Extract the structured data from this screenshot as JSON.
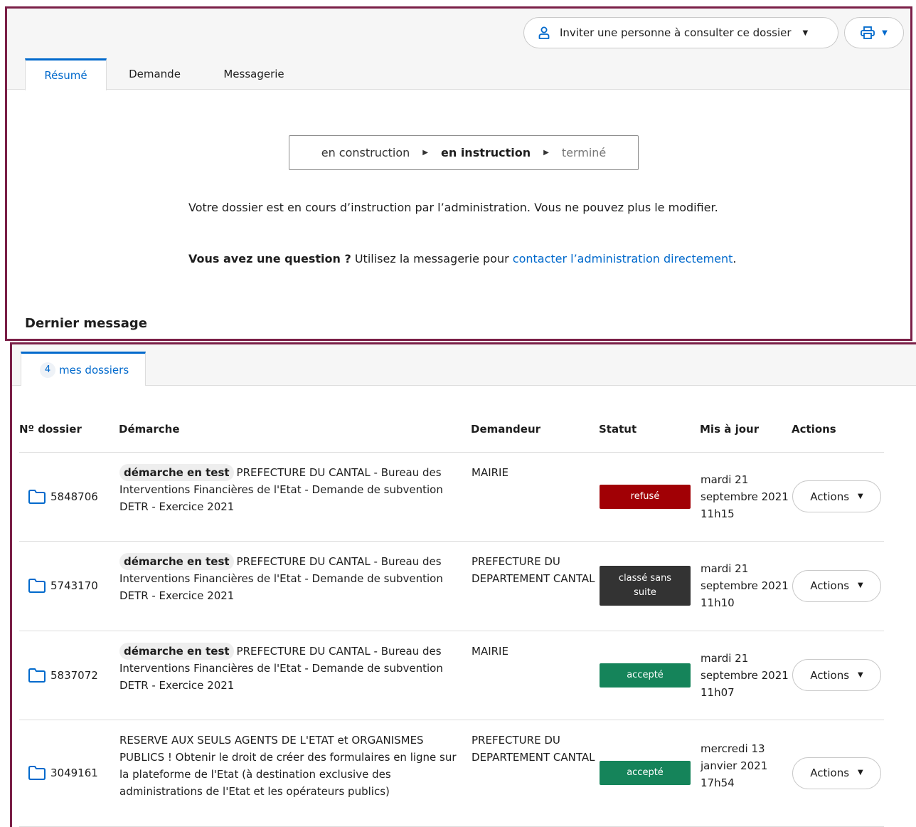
{
  "header": {
    "invite_label": "Inviter une personne à consulter ce dossier",
    "invite_icon": "user-icon",
    "print_icon": "printer-icon",
    "accent_color": "#0069cc"
  },
  "tabs": [
    {
      "label": "Résumé",
      "active": true
    },
    {
      "label": "Demande",
      "active": false
    },
    {
      "label": "Messagerie",
      "active": false
    }
  ],
  "status_steps": [
    "en construction",
    "en instruction",
    "terminé"
  ],
  "status_text": "Votre dossier est en cours d’instruction par l’administration. Vous ne pouvez plus le modifier.",
  "question": {
    "bold": "Vous avez une question ?",
    "text": "Utilisez la messagerie pour",
    "link": "contacter l’administration directement",
    "end": "."
  },
  "last_message_title": "Dernier message",
  "dossiers_tab": {
    "count": "4",
    "label": "mes dossiers"
  },
  "table": {
    "headers": [
      "Nº dossier",
      "Démarche",
      "Demandeur",
      "Statut",
      "Mis à jour",
      "Actions"
    ],
    "rows": [
      {
        "number": "5848706",
        "badge": "démarche en test",
        "demarche": "PREFECTURE DU CANTAL - Bureau des Interventions Financières de l'Etat - Demande de subvention DETR - Exercice 2021",
        "demandeur": "MAIRIE",
        "status": "refusé",
        "status_color": "#a10005",
        "updated": "mardi 21 septembre 2021 11h15",
        "action": "Actions"
      },
      {
        "number": "5743170",
        "badge": "démarche en test",
        "demarche": "PREFECTURE DU CANTAL - Bureau des Interventions Financières de l'Etat - Demande de subvention DETR - Exercice 2021",
        "demandeur": "PREFECTURE DU DEPARTEMENT CANTAL",
        "status": "classé sans suite",
        "status_color": "#333333",
        "updated": "mardi 21 septembre 2021 11h10",
        "action": "Actions"
      },
      {
        "number": "5837072",
        "badge": "démarche en test",
        "demarche": "PREFECTURE DU CANTAL - Bureau des Interventions Financières de l'Etat - Demande de subvention DETR - Exercice 2021",
        "demandeur": "MAIRIE",
        "status": "accepté",
        "status_color": "#15845a",
        "updated": "mardi 21 septembre 2021 11h07",
        "action": "Actions"
      },
      {
        "number": "3049161",
        "badge": "",
        "demarche": "RESERVE AUX SEULS AGENTS DE L'ETAT et ORGANISMES PUBLICS ! Obtenir le droit de créer des formulaires en ligne sur la plateforme de l'Etat (à destination exclusive des administrations de l'Etat et les opérateurs publics)",
        "demandeur": "PREFECTURE DU DEPARTEMENT CANTAL",
        "status": "accepté",
        "status_color": "#15845a",
        "updated": "mercredi 13 janvier 2021 17h54",
        "action": "Actions"
      }
    ]
  }
}
